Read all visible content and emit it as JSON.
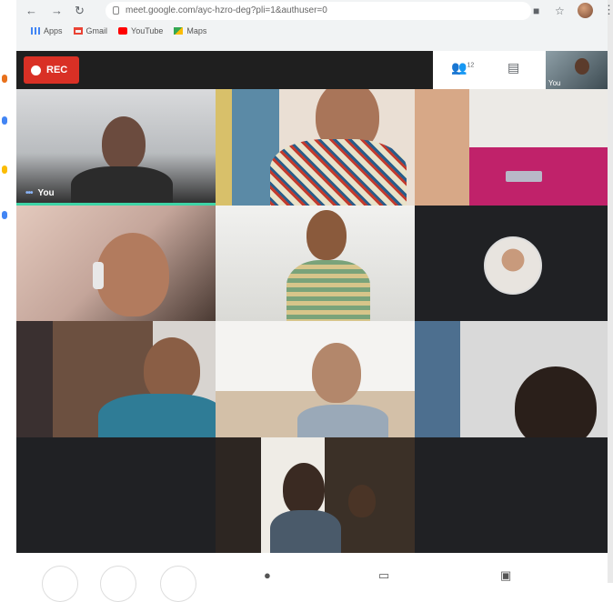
{
  "browser": {
    "url": "meet.google.com/ayc-hzro-deg?pli=1&authuser=0",
    "bookmarks": [
      {
        "label": "Apps",
        "icon": "apps-grid-icon",
        "color": "#4285f4"
      },
      {
        "label": "Gmail",
        "icon": "gmail-icon",
        "color": "#ea4335"
      },
      {
        "label": "YouTube",
        "icon": "youtube-icon",
        "color": "#ff0000"
      },
      {
        "label": "Maps",
        "icon": "maps-icon",
        "color": "#34a853"
      }
    ]
  },
  "meeting": {
    "rec_label": "REC",
    "participants_badge": "12",
    "self_label": "You",
    "active_tile_label": "You"
  },
  "colors": {
    "rec": "#d93025",
    "active_border": "#3fd4a6",
    "meet_dark": "#202124"
  }
}
